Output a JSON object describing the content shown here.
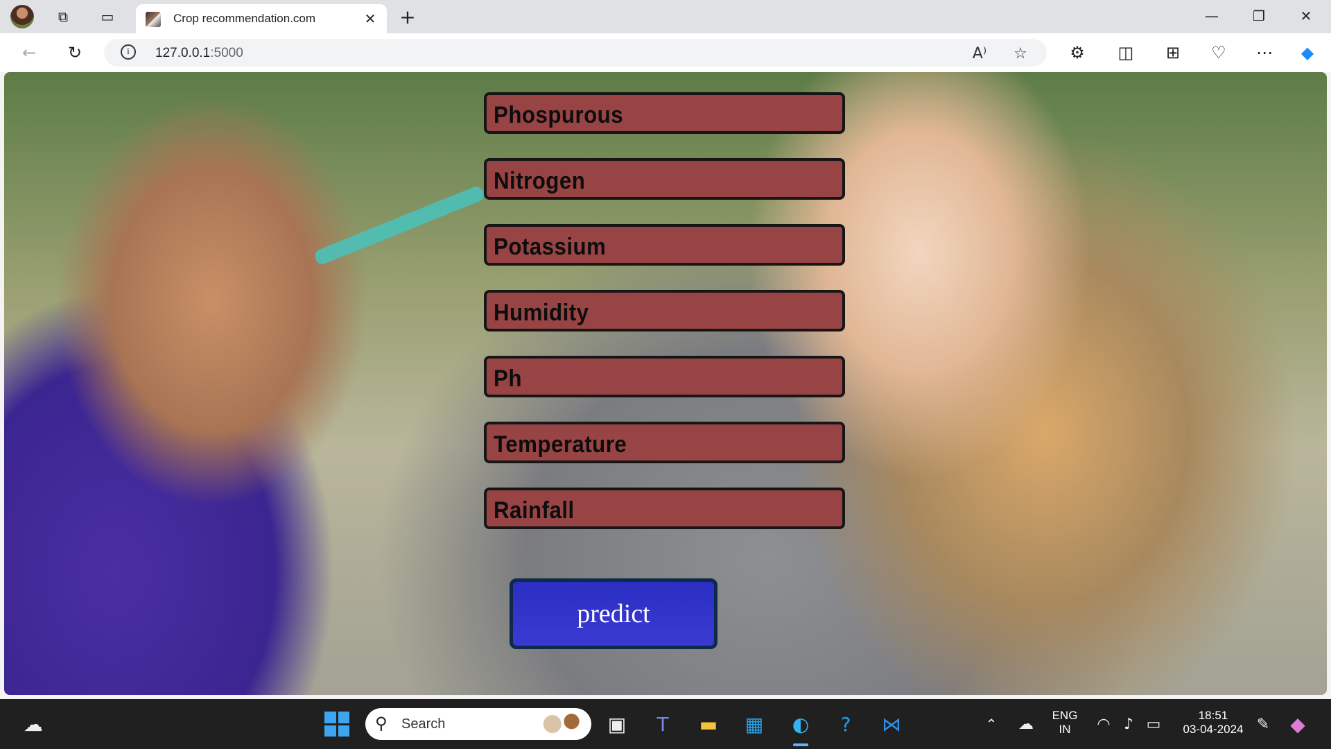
{
  "browser": {
    "tab_title": "Crop recommendation.com",
    "address_host": "127.0.0.1",
    "address_port": ":5000",
    "new_tab_label": "+"
  },
  "form": {
    "fields": [
      {
        "label": "Phospurous"
      },
      {
        "label": "Nitrogen"
      },
      {
        "label": "Potassium"
      },
      {
        "label": "Humidity"
      },
      {
        "label": "Ph"
      },
      {
        "label": "Temperature"
      },
      {
        "label": "Rainfall"
      }
    ],
    "submit_label": "predict"
  },
  "taskbar": {
    "search_label": "Search",
    "language_top": "ENG",
    "language_bottom": "IN",
    "time": "18:51",
    "date": "03-04-2024"
  },
  "colors": {
    "field_bg": "#984444",
    "field_border": "#161616",
    "button_bg": "#2b2fc2",
    "button_border": "#0d2a4a"
  }
}
